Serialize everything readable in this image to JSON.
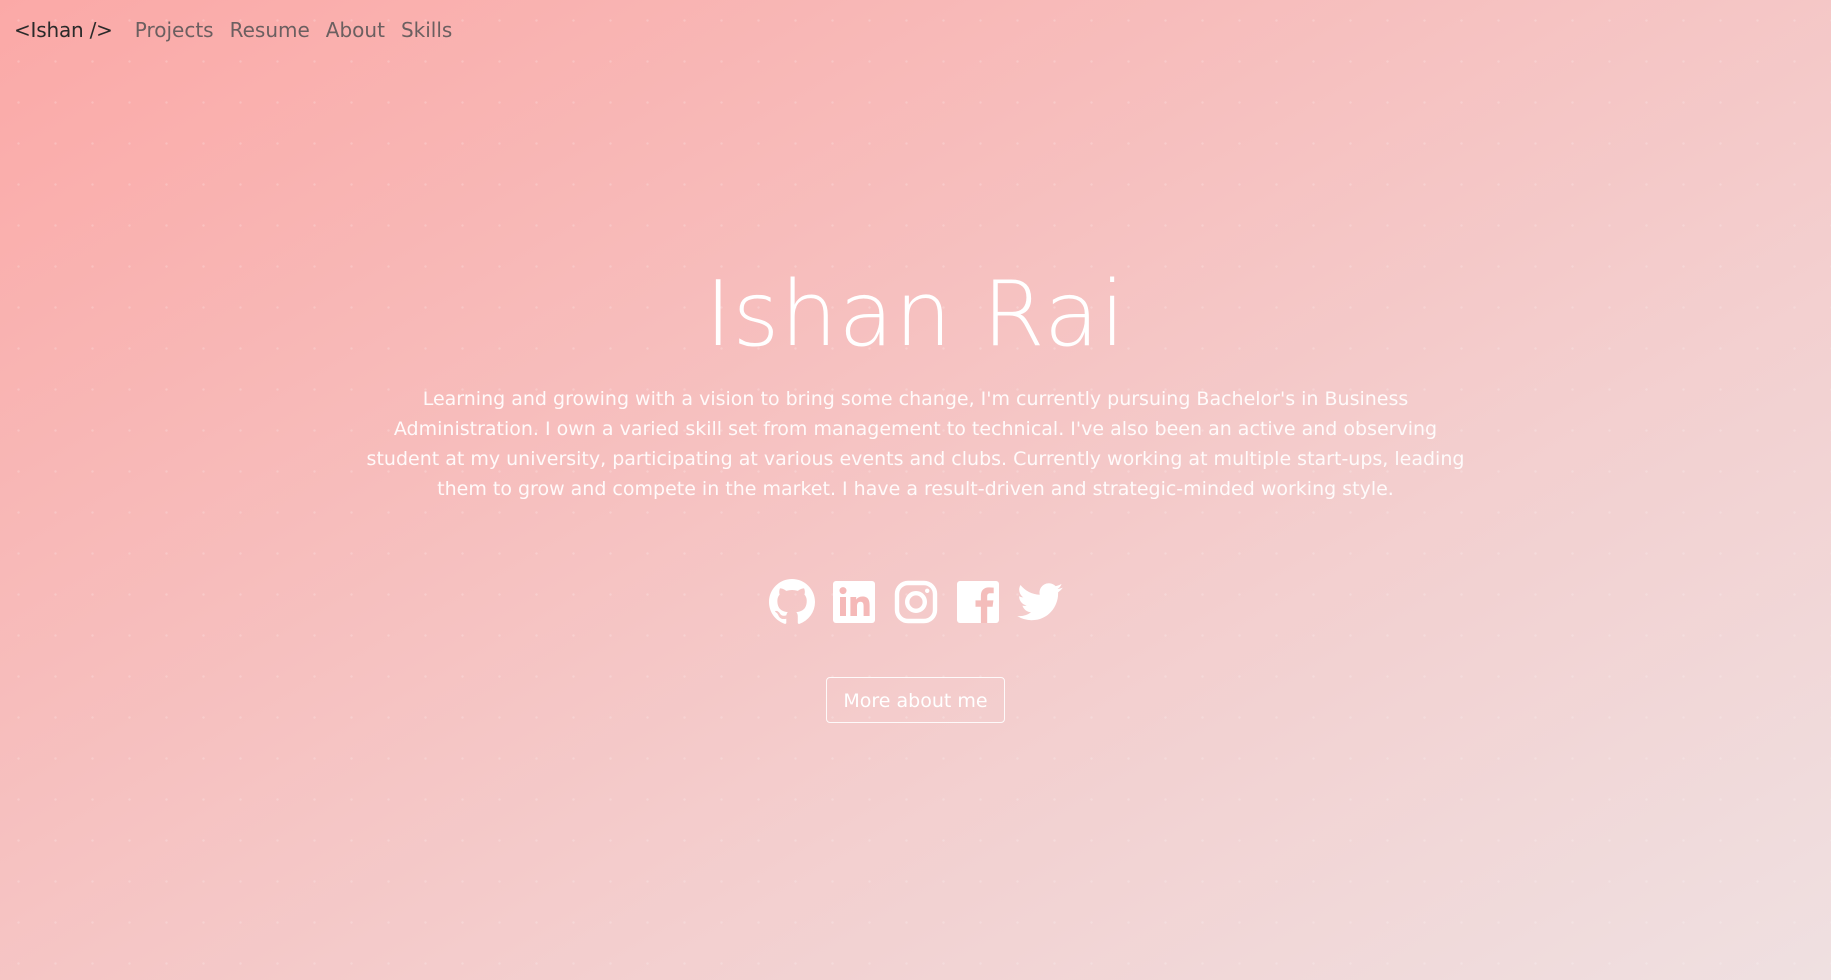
{
  "nav": {
    "brand": "<Ishan />",
    "links": [
      "Projects",
      "Resume",
      "About",
      "Skills"
    ]
  },
  "hero": {
    "name": "Ishan Rai",
    "bio": "Learning and growing with a vision to bring some change, I'm currently pursuing Bachelor's in Business Administration. I own a varied skill set from management to technical. I've also been an active and observing student at my university, participating at various events and clubs. Currently working at multiple start-ups, leading them to grow and compete in the market. I have a result-driven and strategic-minded working style.",
    "cta_label": "More about me"
  },
  "socials": [
    {
      "icon": "github-icon"
    },
    {
      "icon": "linkedin-icon"
    },
    {
      "icon": "instagram-icon"
    },
    {
      "icon": "facebook-icon"
    },
    {
      "icon": "twitter-icon"
    }
  ],
  "colors": {
    "gradient_start": "#fba9a7",
    "gradient_end": "#efe0e1",
    "hero_text": "#ffffff",
    "brand_text": "#2a2a2a",
    "nav_text": "#6b5f60"
  }
}
